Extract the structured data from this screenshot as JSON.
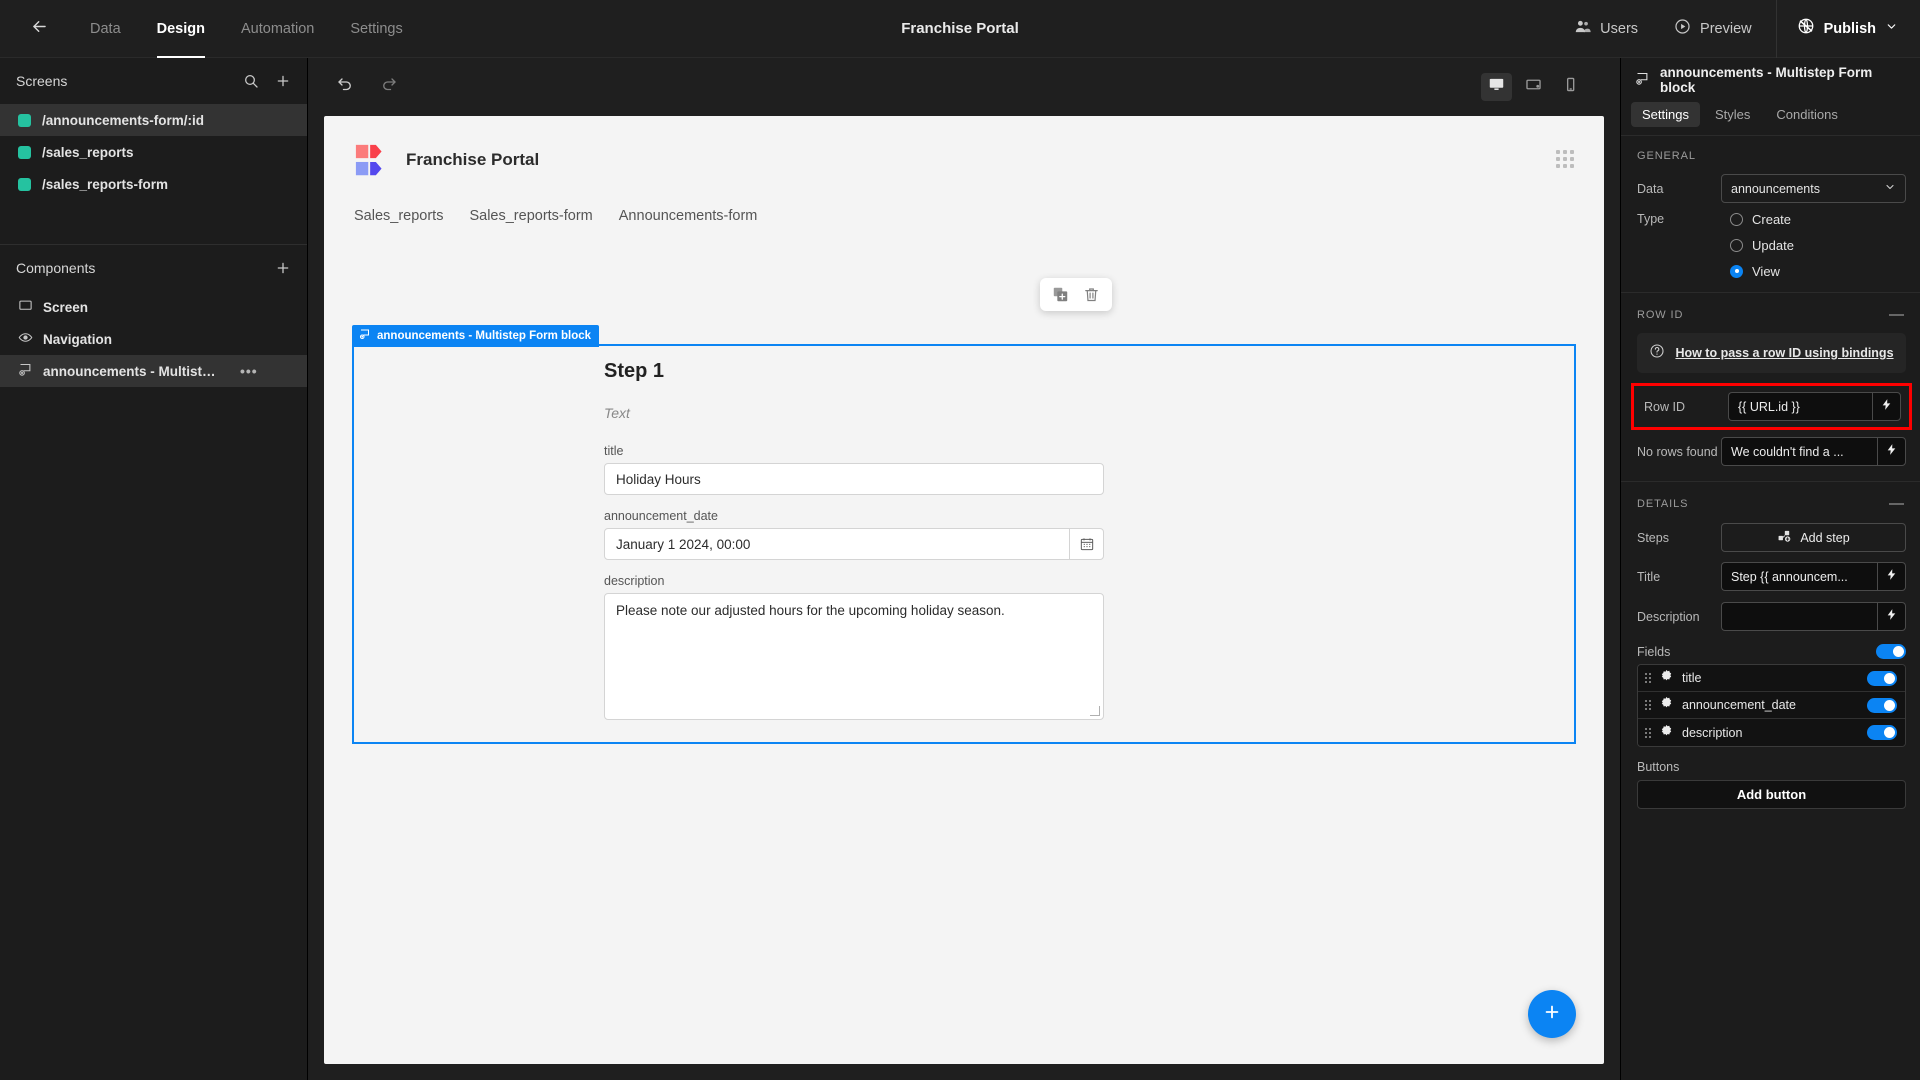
{
  "topbar": {
    "back_icon": "arrow-left-icon",
    "nav": [
      {
        "label": "Data",
        "active": false
      },
      {
        "label": "Design",
        "active": true
      },
      {
        "label": "Automation",
        "active": false
      },
      {
        "label": "Settings",
        "active": false
      }
    ],
    "title": "Franchise Portal",
    "users_label": "Users",
    "preview_label": "Preview",
    "publish_label": "Publish"
  },
  "screens_panel": {
    "title": "Screens",
    "search_icon": "search-icon",
    "add_icon": "plus-icon",
    "items": [
      {
        "label": "/announcements-form/:id",
        "color": "#25c2a0",
        "selected": true
      },
      {
        "label": "/sales_reports",
        "color": "#25c2a0",
        "selected": false
      },
      {
        "label": "/sales_reports-form",
        "color": "#25c2a0",
        "selected": false
      }
    ]
  },
  "components_panel": {
    "title": "Components",
    "add_icon": "plus-icon",
    "items": [
      {
        "label": "Screen",
        "icon": "screen-icon",
        "selected": false,
        "menu": false
      },
      {
        "label": "Navigation",
        "icon": "eye-icon",
        "selected": false,
        "menu": false
      },
      {
        "label": "announcements - Multistep ...",
        "icon": "form-block-icon",
        "selected": true,
        "menu": true,
        "menu_glyph": "•••"
      }
    ]
  },
  "center_toolbar": {
    "undo_icon": "undo-icon",
    "redo_icon": "redo-icon",
    "devices": [
      {
        "name": "desktop-icon",
        "active": true
      },
      {
        "name": "tablet-icon",
        "active": false
      },
      {
        "name": "mobile-icon",
        "active": false
      }
    ]
  },
  "canvas": {
    "app_name": "Franchise Portal",
    "logo_icon": "budibase-logo",
    "grid_handle_icon": "drag-grid-icon",
    "nav_links": [
      "Sales_reports",
      "Sales_reports-form",
      "Announcements-form"
    ],
    "float_tools": [
      {
        "name": "duplicate-icon",
        "glyph": "duplicate"
      },
      {
        "name": "delete-icon",
        "glyph": "trash"
      }
    ],
    "block_tag": "announcements - Multistep Form block",
    "block_tag_icon": "form-block-icon",
    "step_title": "Step 1",
    "step_text": "Text",
    "fields": [
      {
        "label": "title",
        "value": "Holiday Hours",
        "type": "text"
      },
      {
        "label": "announcement_date",
        "value": "January 1 2024, 00:00",
        "type": "date",
        "icon": "calendar-icon"
      },
      {
        "label": "description",
        "value": "Please note our adjusted hours for the upcoming holiday season.",
        "type": "textarea"
      }
    ],
    "fab_icon": "plus-icon"
  },
  "right_panel": {
    "title": "announcements - Multistep Form block",
    "title_icon": "form-block-icon",
    "tabs": [
      {
        "label": "Settings",
        "active": true
      },
      {
        "label": "Styles",
        "active": false
      },
      {
        "label": "Conditions",
        "active": false
      }
    ],
    "general": {
      "heading": "GENERAL",
      "collapse_glyph": "—",
      "data_label": "Data",
      "data_value": "announcements",
      "type_label": "Type",
      "type_options": [
        {
          "label": "Create",
          "selected": false
        },
        {
          "label": "Update",
          "selected": false
        },
        {
          "label": "View",
          "selected": true
        }
      ]
    },
    "row_id": {
      "heading": "ROW ID",
      "collapse_glyph": "—",
      "help_icon": "question-circle-icon",
      "help_link": "How to pass a row ID using bindings",
      "row_id_label": "Row ID",
      "row_id_value": "{{ URL.id }}",
      "no_rows_label": "No rows found",
      "no_rows_value": "We couldn't find a ...",
      "binding_icon": "lightning-icon",
      "highlight_color": "#ff0000"
    },
    "details": {
      "heading": "DETAILS",
      "collapse_glyph": "—",
      "steps_label": "Steps",
      "add_step_label": "Add step",
      "add_step_icon": "add-step-icon",
      "title_label": "Title",
      "title_value": "Step {{ announcem...",
      "description_label": "Description",
      "description_value": "",
      "fields_label": "Fields",
      "fields": [
        {
          "name": "title",
          "enabled": true,
          "gear_icon": "gear-icon",
          "drag_icon": "drag-handle-icon"
        },
        {
          "name": "announcement_date",
          "enabled": true,
          "gear_icon": "gear-icon",
          "drag_icon": "drag-handle-icon"
        },
        {
          "name": "description",
          "enabled": true,
          "gear_icon": "gear-icon",
          "drag_icon": "drag-handle-icon"
        }
      ],
      "buttons_label": "Buttons",
      "add_button_label": "Add button"
    }
  },
  "colors": {
    "accent": "#0b84f3",
    "screen_dot": "#25c2a0",
    "highlight": "#ff0000",
    "panel_bg": "#1c1c1c",
    "canvas_bg": "#f4f4f4"
  }
}
